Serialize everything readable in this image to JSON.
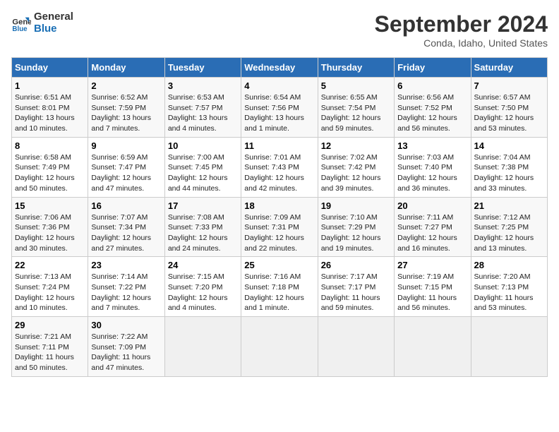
{
  "logo": {
    "line1": "General",
    "line2": "Blue"
  },
  "title": "September 2024",
  "location": "Conda, Idaho, United States",
  "days_of_week": [
    "Sunday",
    "Monday",
    "Tuesday",
    "Wednesday",
    "Thursday",
    "Friday",
    "Saturday"
  ],
  "weeks": [
    [
      {
        "day": "1",
        "info": "Sunrise: 6:51 AM\nSunset: 8:01 PM\nDaylight: 13 hours\nand 10 minutes."
      },
      {
        "day": "2",
        "info": "Sunrise: 6:52 AM\nSunset: 7:59 PM\nDaylight: 13 hours\nand 7 minutes."
      },
      {
        "day": "3",
        "info": "Sunrise: 6:53 AM\nSunset: 7:57 PM\nDaylight: 13 hours\nand 4 minutes."
      },
      {
        "day": "4",
        "info": "Sunrise: 6:54 AM\nSunset: 7:56 PM\nDaylight: 13 hours\nand 1 minute."
      },
      {
        "day": "5",
        "info": "Sunrise: 6:55 AM\nSunset: 7:54 PM\nDaylight: 12 hours\nand 59 minutes."
      },
      {
        "day": "6",
        "info": "Sunrise: 6:56 AM\nSunset: 7:52 PM\nDaylight: 12 hours\nand 56 minutes."
      },
      {
        "day": "7",
        "info": "Sunrise: 6:57 AM\nSunset: 7:50 PM\nDaylight: 12 hours\nand 53 minutes."
      }
    ],
    [
      {
        "day": "8",
        "info": "Sunrise: 6:58 AM\nSunset: 7:49 PM\nDaylight: 12 hours\nand 50 minutes."
      },
      {
        "day": "9",
        "info": "Sunrise: 6:59 AM\nSunset: 7:47 PM\nDaylight: 12 hours\nand 47 minutes."
      },
      {
        "day": "10",
        "info": "Sunrise: 7:00 AM\nSunset: 7:45 PM\nDaylight: 12 hours\nand 44 minutes."
      },
      {
        "day": "11",
        "info": "Sunrise: 7:01 AM\nSunset: 7:43 PM\nDaylight: 12 hours\nand 42 minutes."
      },
      {
        "day": "12",
        "info": "Sunrise: 7:02 AM\nSunset: 7:42 PM\nDaylight: 12 hours\nand 39 minutes."
      },
      {
        "day": "13",
        "info": "Sunrise: 7:03 AM\nSunset: 7:40 PM\nDaylight: 12 hours\nand 36 minutes."
      },
      {
        "day": "14",
        "info": "Sunrise: 7:04 AM\nSunset: 7:38 PM\nDaylight: 12 hours\nand 33 minutes."
      }
    ],
    [
      {
        "day": "15",
        "info": "Sunrise: 7:06 AM\nSunset: 7:36 PM\nDaylight: 12 hours\nand 30 minutes."
      },
      {
        "day": "16",
        "info": "Sunrise: 7:07 AM\nSunset: 7:34 PM\nDaylight: 12 hours\nand 27 minutes."
      },
      {
        "day": "17",
        "info": "Sunrise: 7:08 AM\nSunset: 7:33 PM\nDaylight: 12 hours\nand 24 minutes."
      },
      {
        "day": "18",
        "info": "Sunrise: 7:09 AM\nSunset: 7:31 PM\nDaylight: 12 hours\nand 22 minutes."
      },
      {
        "day": "19",
        "info": "Sunrise: 7:10 AM\nSunset: 7:29 PM\nDaylight: 12 hours\nand 19 minutes."
      },
      {
        "day": "20",
        "info": "Sunrise: 7:11 AM\nSunset: 7:27 PM\nDaylight: 12 hours\nand 16 minutes."
      },
      {
        "day": "21",
        "info": "Sunrise: 7:12 AM\nSunset: 7:25 PM\nDaylight: 12 hours\nand 13 minutes."
      }
    ],
    [
      {
        "day": "22",
        "info": "Sunrise: 7:13 AM\nSunset: 7:24 PM\nDaylight: 12 hours\nand 10 minutes."
      },
      {
        "day": "23",
        "info": "Sunrise: 7:14 AM\nSunset: 7:22 PM\nDaylight: 12 hours\nand 7 minutes."
      },
      {
        "day": "24",
        "info": "Sunrise: 7:15 AM\nSunset: 7:20 PM\nDaylight: 12 hours\nand 4 minutes."
      },
      {
        "day": "25",
        "info": "Sunrise: 7:16 AM\nSunset: 7:18 PM\nDaylight: 12 hours\nand 1 minute."
      },
      {
        "day": "26",
        "info": "Sunrise: 7:17 AM\nSunset: 7:17 PM\nDaylight: 11 hours\nand 59 minutes."
      },
      {
        "day": "27",
        "info": "Sunrise: 7:19 AM\nSunset: 7:15 PM\nDaylight: 11 hours\nand 56 minutes."
      },
      {
        "day": "28",
        "info": "Sunrise: 7:20 AM\nSunset: 7:13 PM\nDaylight: 11 hours\nand 53 minutes."
      }
    ],
    [
      {
        "day": "29",
        "info": "Sunrise: 7:21 AM\nSunset: 7:11 PM\nDaylight: 11 hours\nand 50 minutes."
      },
      {
        "day": "30",
        "info": "Sunrise: 7:22 AM\nSunset: 7:09 PM\nDaylight: 11 hours\nand 47 minutes."
      },
      null,
      null,
      null,
      null,
      null
    ]
  ]
}
